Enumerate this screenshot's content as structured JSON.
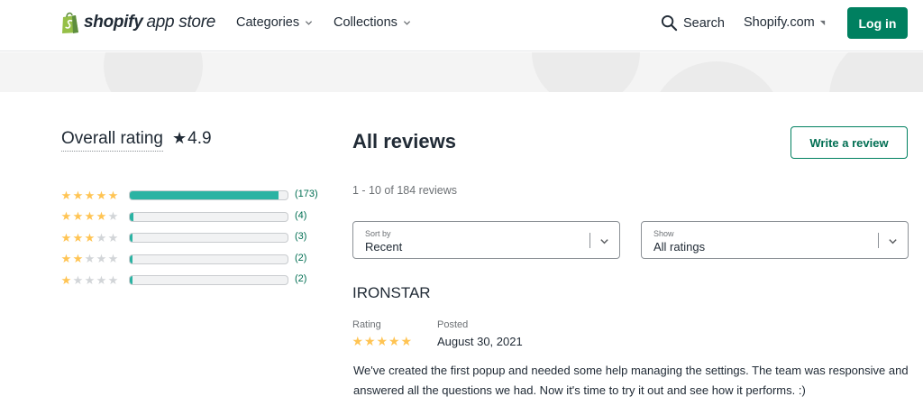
{
  "header": {
    "brand": "shopify",
    "brand_suffix": "app store",
    "nav": [
      {
        "label": "Categories"
      },
      {
        "label": "Collections"
      }
    ],
    "search_label": "Search",
    "shopify_link": "Shopify.com",
    "login_label": "Log in",
    "accent_color": "#008060"
  },
  "rating_summary": {
    "label": "Overall rating",
    "score": "4.9",
    "distribution": [
      {
        "stars": 5,
        "fraction": 0.94,
        "count": "(173)"
      },
      {
        "stars": 4,
        "fraction": 0.022,
        "count": "(4)"
      },
      {
        "stars": 3,
        "fraction": 0.016,
        "count": "(3)"
      },
      {
        "stars": 2,
        "fraction": 0.011,
        "count": "(2)"
      },
      {
        "stars": 1,
        "fraction": 0.011,
        "count": "(2)"
      }
    ],
    "bar_color": "#2bb3a3",
    "star_color": "#ffc453"
  },
  "reviews": {
    "title": "All reviews",
    "write_label": "Write a review",
    "range_text": "1 - 10 of 184 reviews",
    "sort": {
      "label": "Sort by",
      "value": "Recent"
    },
    "show": {
      "label": "Show",
      "value": "All ratings"
    },
    "items": [
      {
        "author": "IRONSTAR",
        "rating_label": "Rating",
        "rating": 5,
        "posted_label": "Posted",
        "posted": "August 30, 2021",
        "body": "We've created the first popup and needed some help managing the settings. The team was responsive and answered all the questions we had. Now it's time to try it out and see how it performs. :)"
      }
    ]
  }
}
